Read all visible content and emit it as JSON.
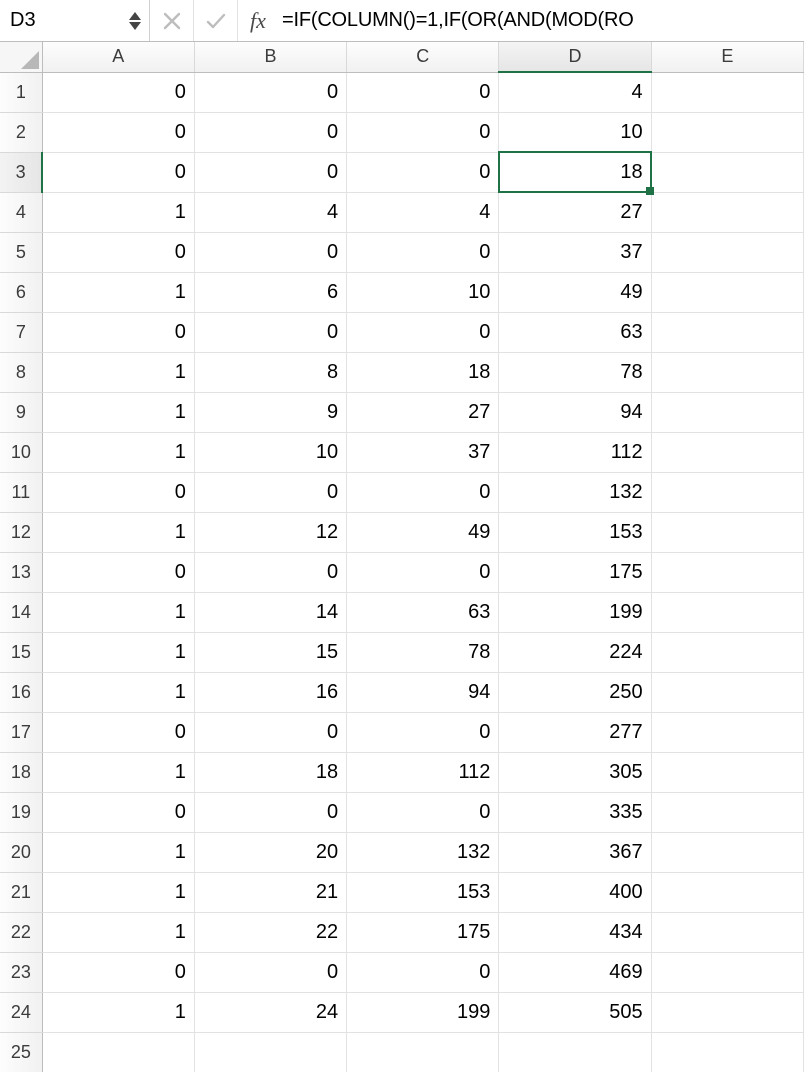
{
  "name_box": {
    "value": "D3"
  },
  "formula_bar": {
    "fx_label": "fx",
    "formula": "=IF(COLUMN()=1,IF(OR(AND(MOD(RO"
  },
  "columns": [
    "A",
    "B",
    "C",
    "D",
    "E"
  ],
  "selected_cell": {
    "row": 3,
    "col": "D"
  },
  "rows": [
    {
      "n": 1,
      "A": "0",
      "B": "0",
      "C": "0",
      "D": "4",
      "E": ""
    },
    {
      "n": 2,
      "A": "0",
      "B": "0",
      "C": "0",
      "D": "10",
      "E": ""
    },
    {
      "n": 3,
      "A": "0",
      "B": "0",
      "C": "0",
      "D": "18",
      "E": ""
    },
    {
      "n": 4,
      "A": "1",
      "B": "4",
      "C": "4",
      "D": "27",
      "E": ""
    },
    {
      "n": 5,
      "A": "0",
      "B": "0",
      "C": "0",
      "D": "37",
      "E": ""
    },
    {
      "n": 6,
      "A": "1",
      "B": "6",
      "C": "10",
      "D": "49",
      "E": ""
    },
    {
      "n": 7,
      "A": "0",
      "B": "0",
      "C": "0",
      "D": "63",
      "E": ""
    },
    {
      "n": 8,
      "A": "1",
      "B": "8",
      "C": "18",
      "D": "78",
      "E": ""
    },
    {
      "n": 9,
      "A": "1",
      "B": "9",
      "C": "27",
      "D": "94",
      "E": ""
    },
    {
      "n": 10,
      "A": "1",
      "B": "10",
      "C": "37",
      "D": "112",
      "E": ""
    },
    {
      "n": 11,
      "A": "0",
      "B": "0",
      "C": "0",
      "D": "132",
      "E": ""
    },
    {
      "n": 12,
      "A": "1",
      "B": "12",
      "C": "49",
      "D": "153",
      "E": ""
    },
    {
      "n": 13,
      "A": "0",
      "B": "0",
      "C": "0",
      "D": "175",
      "E": ""
    },
    {
      "n": 14,
      "A": "1",
      "B": "14",
      "C": "63",
      "D": "199",
      "E": ""
    },
    {
      "n": 15,
      "A": "1",
      "B": "15",
      "C": "78",
      "D": "224",
      "E": ""
    },
    {
      "n": 16,
      "A": "1",
      "B": "16",
      "C": "94",
      "D": "250",
      "E": ""
    },
    {
      "n": 17,
      "A": "0",
      "B": "0",
      "C": "0",
      "D": "277",
      "E": ""
    },
    {
      "n": 18,
      "A": "1",
      "B": "18",
      "C": "112",
      "D": "305",
      "E": ""
    },
    {
      "n": 19,
      "A": "0",
      "B": "0",
      "C": "0",
      "D": "335",
      "E": ""
    },
    {
      "n": 20,
      "A": "1",
      "B": "20",
      "C": "132",
      "D": "367",
      "E": ""
    },
    {
      "n": 21,
      "A": "1",
      "B": "21",
      "C": "153",
      "D": "400",
      "E": ""
    },
    {
      "n": 22,
      "A": "1",
      "B": "22",
      "C": "175",
      "D": "434",
      "E": ""
    },
    {
      "n": 23,
      "A": "0",
      "B": "0",
      "C": "0",
      "D": "469",
      "E": ""
    },
    {
      "n": 24,
      "A": "1",
      "B": "24",
      "C": "199",
      "D": "505",
      "E": ""
    },
    {
      "n": 25,
      "A": "",
      "B": "",
      "C": "",
      "D": "",
      "E": ""
    }
  ]
}
